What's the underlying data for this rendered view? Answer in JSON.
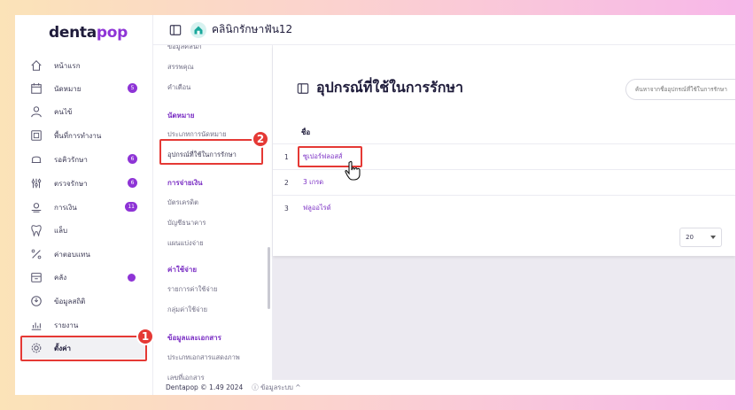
{
  "app": {
    "logo_main": "denta",
    "logo_accent": "pop",
    "clinic_name": "คลินิกรักษาฟัน12",
    "footer_version": "Dentapop © 1.49 2024",
    "footer_info": "ⓘ ข้อมูลระบบ ^"
  },
  "sidebar": {
    "items": [
      {
        "label": "หน้าแรก",
        "icon": "home-icon"
      },
      {
        "label": "นัดหมาย",
        "icon": "calendar-icon",
        "badge": "5"
      },
      {
        "label": "คนไข้",
        "icon": "user-icon"
      },
      {
        "label": "พื้นที่การทำงาน",
        "icon": "workspace-icon"
      },
      {
        "label": "รอคิวรักษา",
        "icon": "chair-icon",
        "badge": "6"
      },
      {
        "label": "ตรวจรักษา",
        "icon": "tools-icon",
        "badge": "6"
      },
      {
        "label": "การเงิน",
        "icon": "money-icon",
        "badge": "11"
      },
      {
        "label": "แล็บ",
        "icon": "tooth-icon"
      },
      {
        "label": "ค่าตอบแทน",
        "icon": "percent-icon"
      },
      {
        "label": "คลัง",
        "icon": "box-icon",
        "dot": true
      },
      {
        "label": "ข้อมูลสถิติ",
        "icon": "stats-icon"
      },
      {
        "label": "รายงาน",
        "icon": "report-icon"
      },
      {
        "label": "ตั้งค่า",
        "icon": "gear-icon"
      }
    ]
  },
  "steps": {
    "one": "1",
    "two": "2"
  },
  "submenu": {
    "cut_item": "ข้อมูลคลินิก",
    "items_top": [
      "สรรพคุณ",
      "คำเตือน"
    ],
    "section_appointment": "นัดหมาย",
    "appointment_items": [
      "ประเภทการนัดหมาย",
      "อุปกรณ์ที่ใช้ในการรักษา"
    ],
    "section_finance": "การจ่ายเงิน",
    "finance_items": [
      "บัตรเครดิต",
      "บัญชีธนาคาร",
      "แผนแบ่งจ่าย"
    ],
    "section_expense": "ค่าใช้จ่าย",
    "expense_items": [
      "รายการค่าใช้จ่าย",
      "กลุ่มค่าใช้จ่าย"
    ],
    "section_docs": "ข้อมูลและเอกสาร",
    "docs_items": [
      "ประเภทเอกสารแสดงภาพ",
      "เลขที่เอกสาร"
    ]
  },
  "main": {
    "title": "อุปกรณ์ที่ใช้ในการรักษา",
    "search_placeholder": "ค้นหาจากชื่ออุปกรณ์ที่ใช้ในการรักษา",
    "column_name": "ชื่อ",
    "rows": [
      {
        "num": "1",
        "name": "ซูเปอร์ฟลอสส์"
      },
      {
        "num": "2",
        "name": "3 เกรด"
      },
      {
        "num": "3",
        "name": "ฟลูออไรด์"
      }
    ],
    "page_size": "20"
  },
  "colors": {
    "accent": "#8e34d6",
    "highlight": "#e53935"
  }
}
